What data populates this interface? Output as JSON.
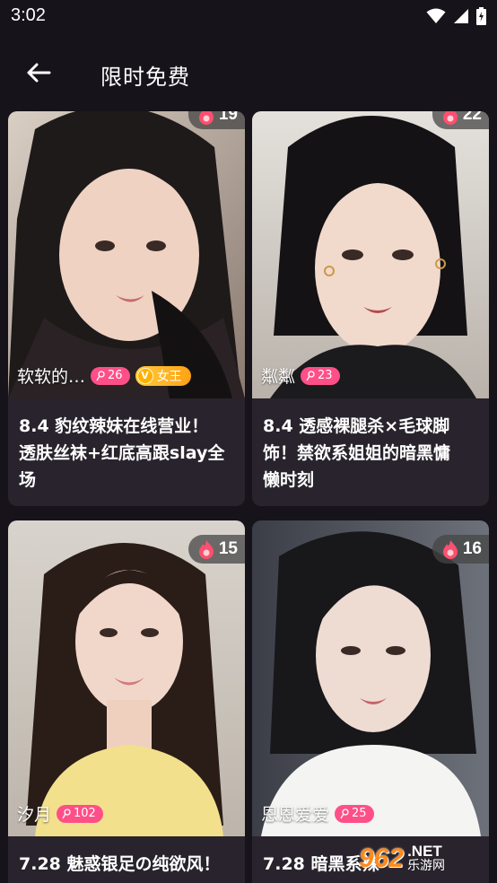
{
  "status_bar": {
    "time": "3:02"
  },
  "header": {
    "title": "限时免费"
  },
  "cards": [
    {
      "fire": "19",
      "author": "软软的…",
      "level": "26",
      "queen_label": "女王",
      "queen_letter": "V",
      "title_lines": [
        "8.4 豹纹辣妹在线营业！",
        "透肤丝袜+红底高跟slay全",
        "场"
      ]
    },
    {
      "fire": "22",
      "author": "粼粼",
      "level": "23",
      "title_lines": [
        "8.4 透感裸腿杀×毛球脚",
        "饰！禁欲系姐姐的暗黑慵",
        "懒时刻"
      ]
    },
    {
      "fire": "15",
      "author": "汐月",
      "level": "102",
      "title_lines": [
        "7.28 魅惑银足の纯欲风！"
      ]
    },
    {
      "fire": "16",
      "author": "恩恩爱爱",
      "level": "25",
      "title_lines": [
        "7.28 暗黑系辣"
      ]
    }
  ],
  "watermark": {
    "logo": "962",
    "net": ".NET",
    "cn": "乐游网"
  },
  "colors": {
    "background": "#17131b",
    "card": "#28232c",
    "level_badge": "#ff4f88",
    "queen_badge": "#ffa215",
    "fire": "#ff4f6e"
  }
}
